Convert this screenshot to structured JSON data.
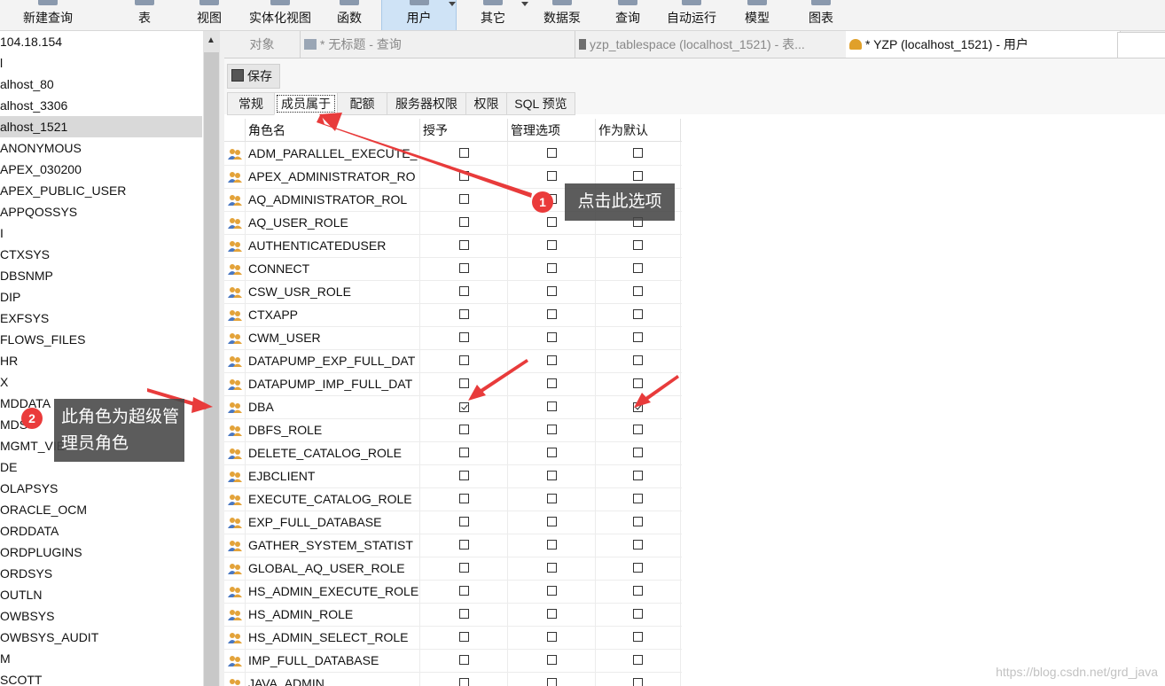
{
  "toolbar": {
    "items": [
      "新建查询",
      "表",
      "视图",
      "实体化视图",
      "函数",
      "用户",
      "其它",
      "数据泵",
      "查询",
      "自动运行",
      "模型",
      "图表"
    ],
    "active": "用户"
  },
  "tree": {
    "items": [
      "104.18.154",
      "l",
      "alhost_80",
      "alhost_3306",
      "alhost_1521",
      "ANONYMOUS",
      "APEX_030200",
      "APEX_PUBLIC_USER",
      "APPQOSSYS",
      "I",
      "CTXSYS",
      "DBSNMP",
      "DIP",
      "EXFSYS",
      "FLOWS_FILES",
      "HR",
      "X",
      "MDDATA",
      "MDS",
      "MGMT_VIE",
      "DE",
      "OLAPSYS",
      "ORACLE_OCM",
      "ORDDATA",
      "ORDPLUGINS",
      "ORDSYS",
      "OUTLN",
      "OWBSYS",
      "OWBSYS_AUDIT",
      "M",
      "SCOTT"
    ],
    "selected_index": 4
  },
  "tabs": {
    "objects": "对象",
    "query": "* 无标题 - 查询",
    "tablespace": "yzp_tablespace (localhost_1521) - 表...",
    "user": "* YZP (localhost_1521) - 用户"
  },
  "save_label": "保存",
  "subtabs": [
    "常规",
    "成员属于",
    "配额",
    "服务器权限",
    "权限",
    "SQL 预览"
  ],
  "subtab_active": "成员属于",
  "grid": {
    "headers": [
      "角色名",
      "授予",
      "管理选项",
      "作为默认"
    ],
    "rows": [
      {
        "name": "ADM_PARALLEL_EXECUTE_",
        "grant": false,
        "admin": false,
        "default": false
      },
      {
        "name": "APEX_ADMINISTRATOR_RO",
        "grant": false,
        "admin": false,
        "default": false
      },
      {
        "name": "AQ_ADMINISTRATOR_ROL",
        "grant": false,
        "admin": false,
        "default": false
      },
      {
        "name": "AQ_USER_ROLE",
        "grant": false,
        "admin": false,
        "default": false
      },
      {
        "name": "AUTHENTICATEDUSER",
        "grant": false,
        "admin": false,
        "default": false
      },
      {
        "name": "CONNECT",
        "grant": false,
        "admin": false,
        "default": false
      },
      {
        "name": "CSW_USR_ROLE",
        "grant": false,
        "admin": false,
        "default": false
      },
      {
        "name": "CTXAPP",
        "grant": false,
        "admin": false,
        "default": false
      },
      {
        "name": "CWM_USER",
        "grant": false,
        "admin": false,
        "default": false
      },
      {
        "name": "DATAPUMP_EXP_FULL_DAT",
        "grant": false,
        "admin": false,
        "default": false
      },
      {
        "name": "DATAPUMP_IMP_FULL_DAT",
        "grant": false,
        "admin": false,
        "default": false
      },
      {
        "name": "DBA",
        "grant": true,
        "admin": false,
        "default": true
      },
      {
        "name": "DBFS_ROLE",
        "grant": false,
        "admin": false,
        "default": false
      },
      {
        "name": "DELETE_CATALOG_ROLE",
        "grant": false,
        "admin": false,
        "default": false
      },
      {
        "name": "EJBCLIENT",
        "grant": false,
        "admin": false,
        "default": false
      },
      {
        "name": "EXECUTE_CATALOG_ROLE",
        "grant": false,
        "admin": false,
        "default": false
      },
      {
        "name": "EXP_FULL_DATABASE",
        "grant": false,
        "admin": false,
        "default": false
      },
      {
        "name": "GATHER_SYSTEM_STATIST",
        "grant": false,
        "admin": false,
        "default": false
      },
      {
        "name": "GLOBAL_AQ_USER_ROLE",
        "grant": false,
        "admin": false,
        "default": false
      },
      {
        "name": "HS_ADMIN_EXECUTE_ROLE",
        "grant": false,
        "admin": false,
        "default": false
      },
      {
        "name": "HS_ADMIN_ROLE",
        "grant": false,
        "admin": false,
        "default": false
      },
      {
        "name": "HS_ADMIN_SELECT_ROLE",
        "grant": false,
        "admin": false,
        "default": false
      },
      {
        "name": "IMP_FULL_DATABASE",
        "grant": false,
        "admin": false,
        "default": false
      },
      {
        "name": "JAVA_ADMIN",
        "grant": false,
        "admin": false,
        "default": false
      }
    ]
  },
  "annotations": {
    "callout1_number": "1",
    "callout1_text": "点击此选项",
    "callout2_number": "2",
    "callout2_text": "此角色为超级管理员角色"
  },
  "watermark": "https://blog.csdn.net/grd_java",
  "colors": {
    "active_tab": "#cfe3f6",
    "arrow": "#e83b3b",
    "callout_bg": "#464646"
  }
}
